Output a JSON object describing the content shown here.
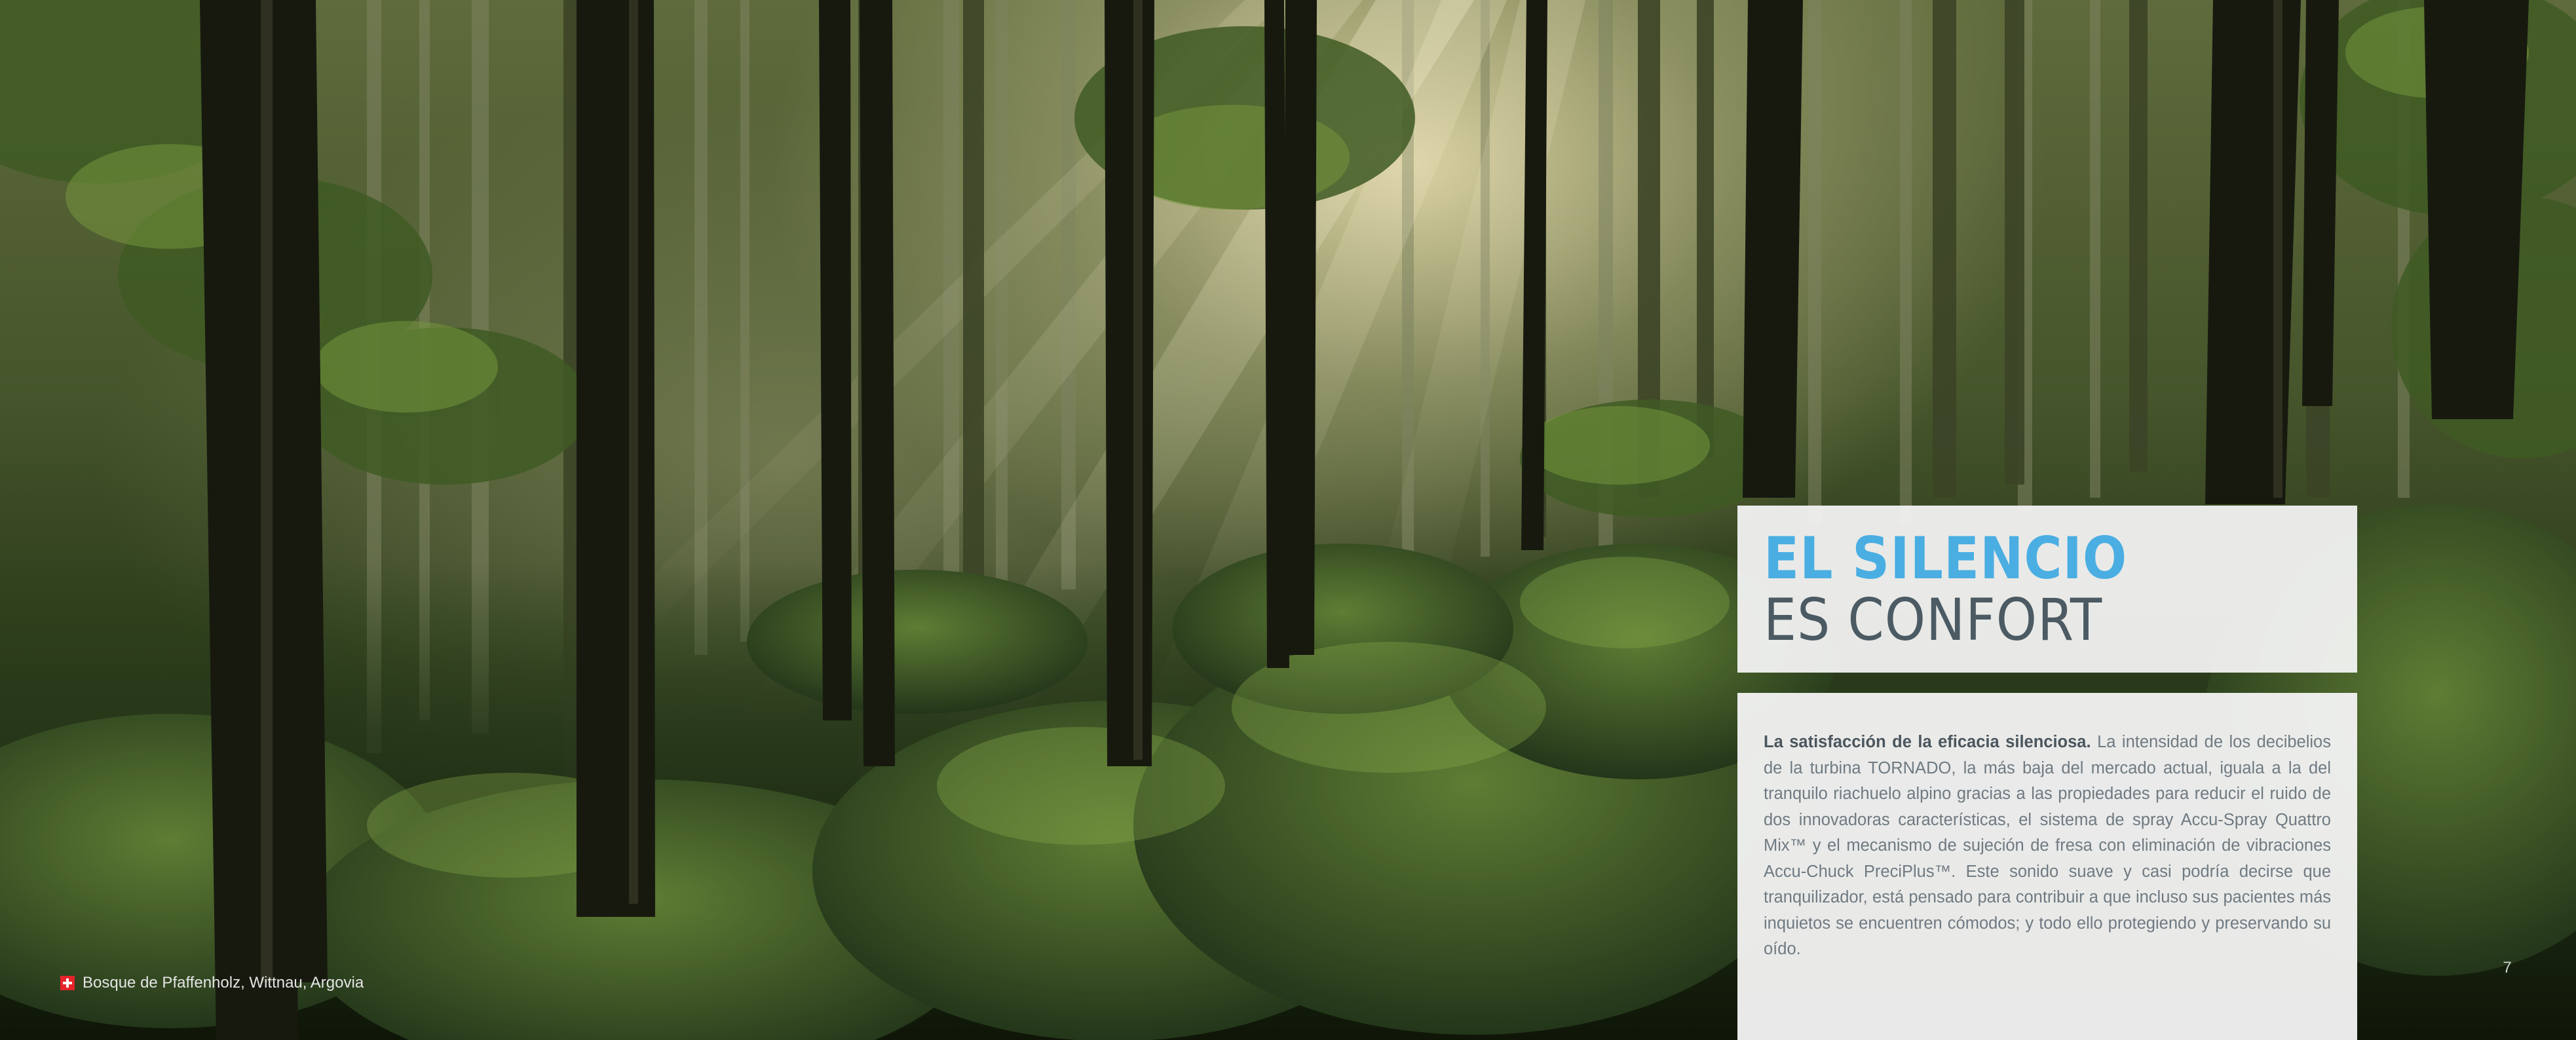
{
  "page": {
    "number": "7"
  },
  "photo": {
    "caption": "Bosque de Pfaffenholz, Wittnau, Argovia",
    "caption_flag_icon": "swiss-flag-icon"
  },
  "heading": {
    "line1": "EL SILENCIO",
    "line2": "ES CONFORT",
    "line1_color": "#4aaee2",
    "line2_color": "#4b5a63"
  },
  "body": {
    "lead": "La satisfacción de la eficacia silenciosa.",
    "text": " La intensidad de los decibelios de la turbina TORNADO, la más baja del mercado actual, iguala a la del tranquilo riachuelo alpino gracias a las propiedades para reducir el ruido de dos innovadoras características, el sistema de spray Accu-Spray Quattro Mix™ y el mecanismo de sujeción de fresa con eliminación de vibraciones Accu-Chuck PreciPlus™. Este sonido suave y casi podría decirse que tranquilizador, está pensado para contribuir a que incluso sus pacientes más inquietos se encuentren cómodos; y todo ello protegiendo y preservando su oído."
  }
}
